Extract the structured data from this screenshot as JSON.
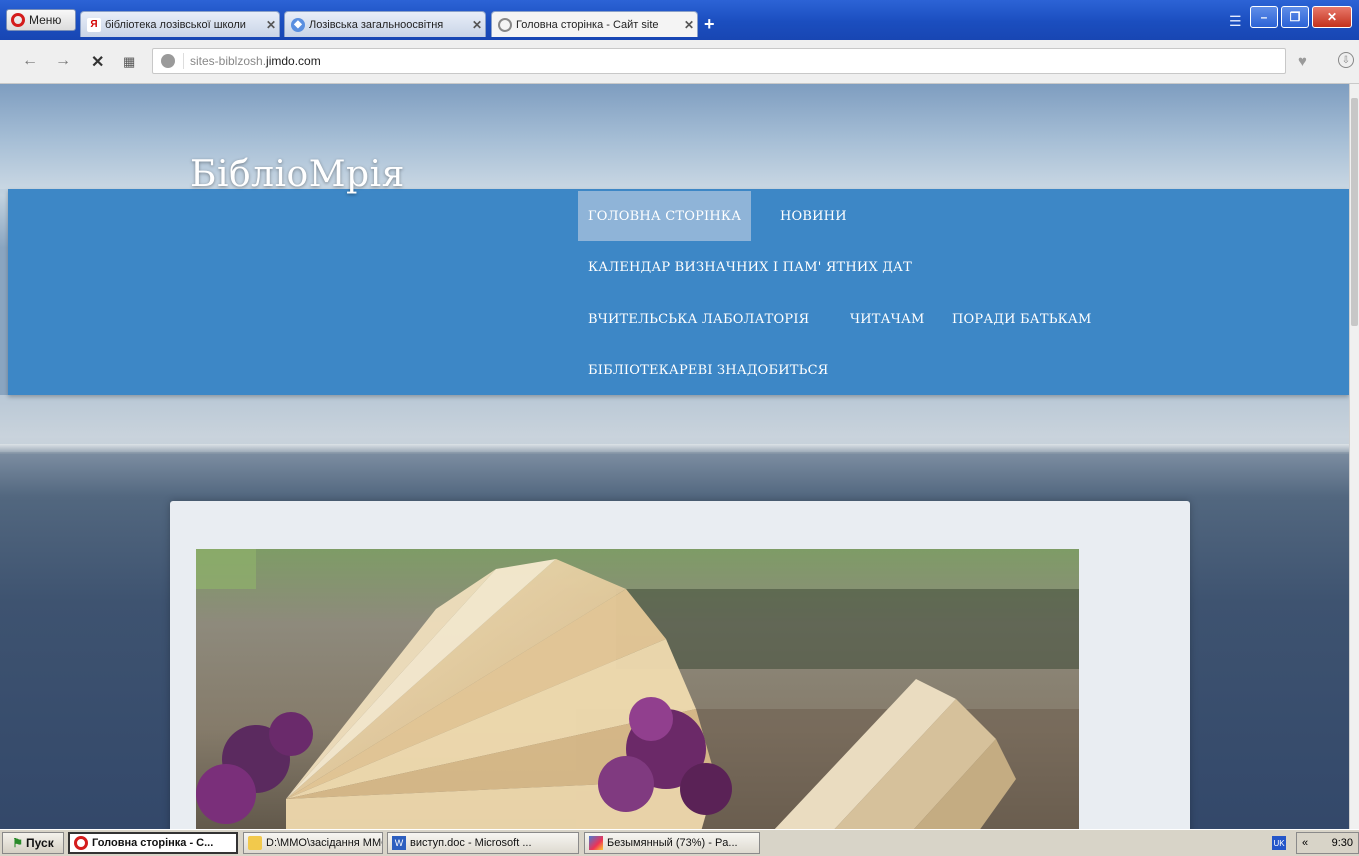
{
  "browser": {
    "menu_label": "Меню",
    "tabs": [
      {
        "title": "бібліотека лозівської школи",
        "icon": "yandex-icon"
      },
      {
        "title": "Лозівська загальноосвітня",
        "icon": "site-icon"
      },
      {
        "title": "Головна сторінка - Сайт site",
        "icon": "loading-icon"
      }
    ],
    "new_tab": "+",
    "url_grey": "sites-biblzosh.",
    "url_dark": "jimdo.com"
  },
  "site": {
    "title": "БібліоМрія",
    "nav": [
      {
        "label": "ГОЛОВНА СТОРІНКА",
        "active": true
      },
      {
        "label": "НОВИНИ"
      },
      {
        "label": "КАЛЕНДАР ВИЗНАЧНИХ І ПАМ' ЯТНИХ ДАТ"
      },
      {
        "label": "ВЧИТЕЛЬСЬКА ЛАБОЛАТОРІЯ"
      },
      {
        "label": "ЧИТАЧАМ"
      },
      {
        "label": "ПОРАДИ БАТЬКАМ"
      },
      {
        "label": "БІБЛІОТЕКАРЕВІ ЗНАДОБИТЬСЯ"
      }
    ]
  },
  "taskbar": {
    "start": "Пуск",
    "tasks": [
      {
        "label": "Головна сторінка - С...",
        "icon": "opera-icon"
      },
      {
        "label": "D:\\ММО\\засідання ММО...",
        "icon": "folder-icon"
      },
      {
        "label": "виступ.doc - Microsoft ...",
        "icon": "word-icon"
      },
      {
        "label": "Безымянный (73%) - Pa...",
        "icon": "paint-icon"
      }
    ],
    "lang": "UK",
    "clock": "9:30",
    "tray_chevron": "«"
  }
}
